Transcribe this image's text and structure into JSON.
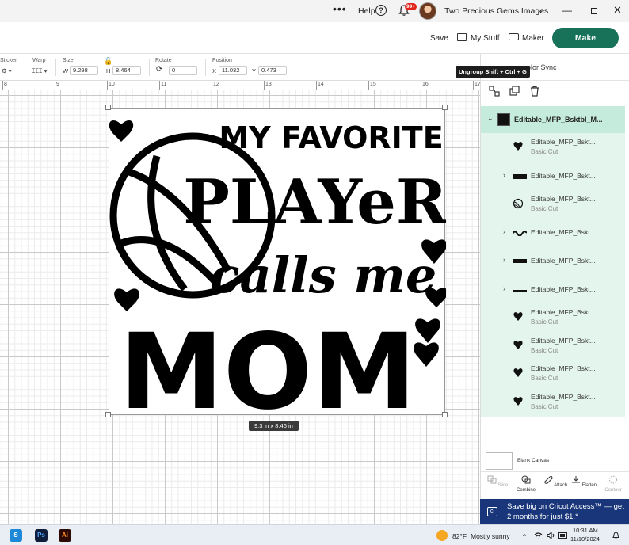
{
  "titlebar": {
    "help": "Help",
    "help_icon": "?",
    "notif_count": "99+",
    "account": "Two Precious Gems Images",
    "acct_chevron": "⌄",
    "min": "—",
    "close": "✕"
  },
  "header": {
    "save": "Save",
    "my_stuff": "My Stuff",
    "maker": "Maker",
    "make": "Make"
  },
  "toolbar": {
    "sticker_label": "Sticker",
    "warp_label": "Warp",
    "size_label": "Size",
    "w_label": "W",
    "w_value": "9.298",
    "h_label": "H",
    "h_value": "8.464",
    "rotate_label": "Rotate",
    "rotate_value": "0",
    "position_label": "Position",
    "x_label": "X",
    "x_value": "11.032",
    "y_label": "Y",
    "y_value": "0.473"
  },
  "ruler": [
    "8",
    "9",
    "10",
    "11",
    "12",
    "13",
    "14",
    "15",
    "16",
    "17"
  ],
  "canvas": {
    "design_text": [
      "MY FAVORITE",
      "PLAYeR",
      "calls me",
      "MOM"
    ],
    "dimension_label": "9.3  in x 8.46  in"
  },
  "panel": {
    "color_sync": "olor Sync",
    "tooltip": "Ungroup Shift + Ctrl + G",
    "group_name": "Editable_MFP_Bsktbl_M...",
    "layers": [
      {
        "name": "Editable_MFP_Bskt...",
        "sub": "Basic Cut",
        "thumb": "heart-icon",
        "expand": false
      },
      {
        "name": "Editable_MFP_Bskt...",
        "sub": "",
        "thumb": "MOM",
        "expand": true
      },
      {
        "name": "Editable_MFP_Bskt...",
        "sub": "Basic Cut",
        "thumb": "basketball-icon",
        "expand": false
      },
      {
        "name": "Editable_MFP_Bskt...",
        "sub": "",
        "thumb": "calls-me",
        "expand": true
      },
      {
        "name": "Editable_MFP_Bskt...",
        "sub": "",
        "thumb": "PLAYER",
        "expand": true
      },
      {
        "name": "Editable_MFP_Bskt...",
        "sub": "",
        "thumb": "MY-FAVORITE",
        "expand": true
      },
      {
        "name": "Editable_MFP_Bskt...",
        "sub": "Basic Cut",
        "thumb": "heart-icon",
        "expand": false
      },
      {
        "name": "Editable_MFP_Bskt...",
        "sub": "Basic Cut",
        "thumb": "heart-icon",
        "expand": false
      },
      {
        "name": "Editable_MFP_Bskt...",
        "sub": "Basic Cut",
        "thumb": "heart-icon",
        "expand": false
      },
      {
        "name": "Editable_MFP_Bskt...",
        "sub": "Basic Cut",
        "thumb": "heart-icon",
        "expand": false
      }
    ],
    "chevron_right": "›",
    "chevron_down": "⌄",
    "blank_canvas": "Blank Canvas",
    "bottom_tools": [
      "Slice",
      "Combine",
      "Attach",
      "Flatten",
      "Contour"
    ]
  },
  "promo": {
    "line1": "Save big on Cricut Access™ — get",
    "line2": "2 months for just $1.*",
    "icon_text": "ci"
  },
  "taskbar": {
    "apps": [
      "S",
      "Ps",
      "Ai"
    ],
    "temp": "82°F",
    "condition": "Mostly sunny",
    "sys_chevron": "^",
    "time": "10:31 AM",
    "date": "11/10/2024"
  },
  "colors": {
    "make_button": "#18725a",
    "layer_panel": "#e4f5ee",
    "layer_selected": "#c5ebdc",
    "promo": "#19367a",
    "notif_badge": "#e2231a"
  }
}
